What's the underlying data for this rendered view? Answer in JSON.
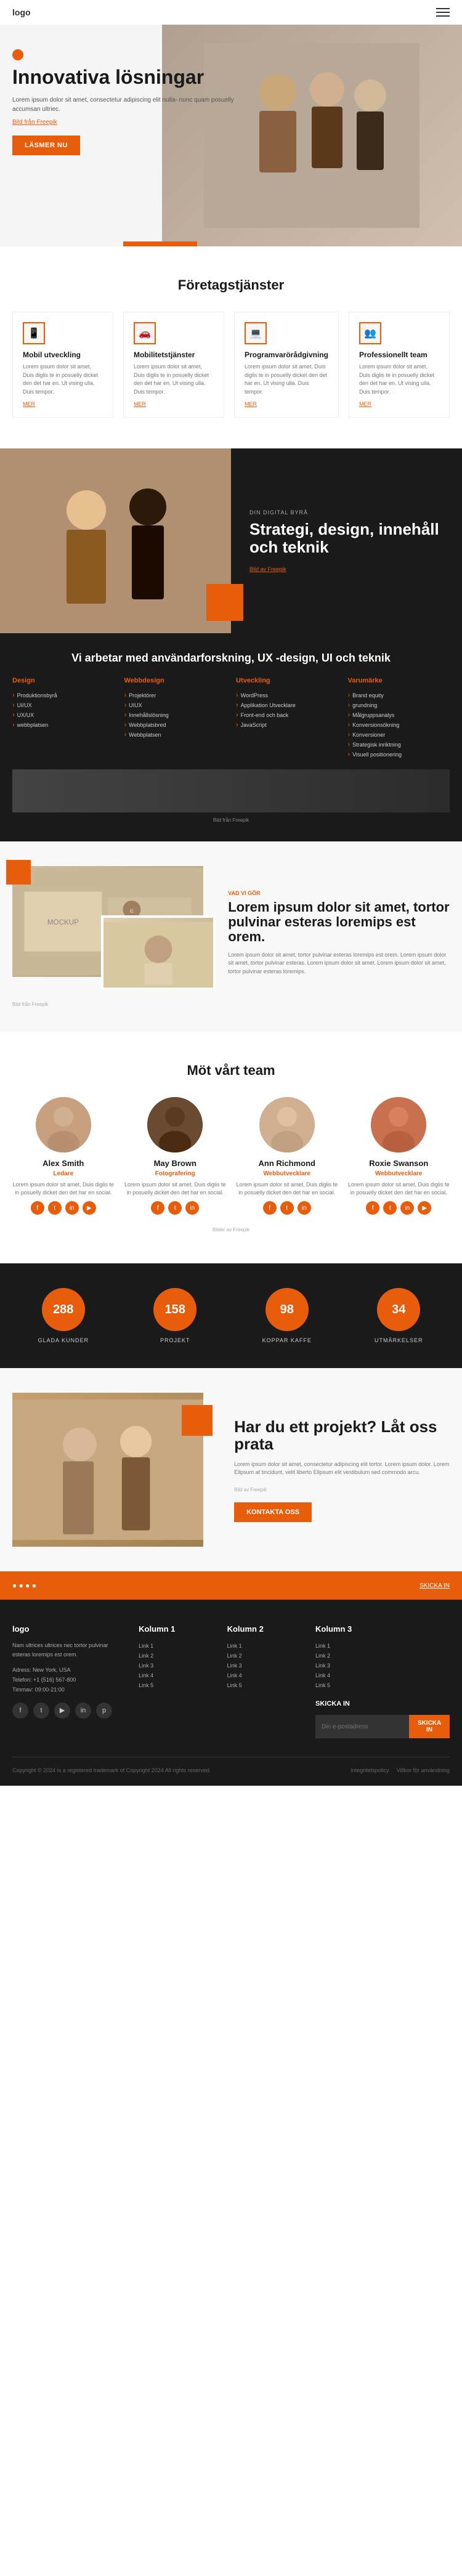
{
  "header": {
    "logo": "logo",
    "hamburger_label": "menu"
  },
  "hero": {
    "title": "Innovativa lösningar",
    "description": "Lorem ipsum dolor sit amet, consectetur adipiscing elit nulla- nunc quam posuelly accumsan ultriec.",
    "photo_credit_label": "Bild från Freepik",
    "button_label": "LÄSMER NU"
  },
  "services_section": {
    "title": "Företagstjänster",
    "cards": [
      {
        "icon": "📱",
        "title": "Mobil utveckling",
        "description": "Lorem ipsum dolor sit amet, Duis diglis te in posuelly dicket den det har en. Ut vising ulla. Duis tempor.",
        "link": "MER"
      },
      {
        "icon": "🚗",
        "title": "Mobilitetstjänster",
        "description": "Lorem ipsum dolor sit amet, Duis diglis te in posuelly dicket den det har en. Ut vising ulla. Duis tempor.",
        "link": "MER"
      },
      {
        "icon": "💻",
        "title": "Programvarörådgivning",
        "description": "Lorem ipsum dolor sit amet, Duis diglis te in posuelly dicket den det har en. Ut vising ulla. Duis tempor.",
        "link": "MER"
      },
      {
        "icon": "👥",
        "title": "Professionellt team",
        "description": "Lorem ipsum dolor sit amet, Duis diglis te in posuelly dicket den det har en. Ut vising ulla. Duis tempor.",
        "link": "MER"
      }
    ]
  },
  "agency_section": {
    "label": "DIN DIGITAL BYRÅ",
    "title": "Strategi, design, innehåll och teknik",
    "photo_credit": "Bild av Freepik"
  },
  "services_list_section": {
    "title": "Vi arbetar med användarforskning, UX -design, UI och teknik",
    "columns": [
      {
        "heading": "Design",
        "items": [
          "Produktionsbyrå",
          "UI/UX",
          "UX/UX",
          "webbplatsen"
        ]
      },
      {
        "heading": "Webbdesign",
        "items": [
          "Projektörer",
          "UIUX",
          "Innehållslösning",
          "Webbplatsbred",
          "Webbplatsen"
        ]
      },
      {
        "heading": "Utveckling",
        "items": [
          "WordPress",
          "Applikation Utvecklare",
          "Front-end och back",
          "JavaScript"
        ]
      },
      {
        "heading": "Varumärke",
        "items": [
          "Brand equity",
          "grundning",
          "Målgruppsanalys",
          "Konversionsökning",
          "Konversioner",
          "Strategisk inriktning",
          "Visuell positionering"
        ]
      }
    ],
    "photo_credit": "Bild från Freepik"
  },
  "what_we_do": {
    "label": "VAD VI GÖR",
    "title": "Lorem ipsum dolor sit amet, tortor pulvinar esteras loremips est orem.",
    "description": "Lorem ipsum dolor sit amet, tortor pulvinar esteras loremips est orem. Lorem ipsum dolor sit amet, tortor pulvinar esteras. Lorem ipsum dolor sit amet. Lorem ipsum dolor sit amet, tortor pulvinar esteras loremips.",
    "photo_credit": "Bild från Freepik"
  },
  "team_section": {
    "title": "Möt vårt team",
    "attribution": "Bilder av Freepik",
    "members": [
      {
        "name": "Alex Smith",
        "role": "Ledare",
        "description": "Lorem ipsum dolor sit amet, Duis diglis te in posuelly dicket den det har en social.",
        "social": [
          "f",
          "t",
          "in",
          "yt"
        ]
      },
      {
        "name": "May Brown",
        "role": "Fotografering",
        "description": "Lorem ipsum dolor sit amet, Duis diglis te in posuelly dicket den det har en social.",
        "social": [
          "f",
          "t",
          "in"
        ]
      },
      {
        "name": "Ann Richmond",
        "role": "Webbutvecklare",
        "description": "Lorem ipsum dolor sit amet, Duis diglis te in posuelly dicket den det har en social.",
        "social": [
          "f",
          "t",
          "in"
        ]
      },
      {
        "name": "Roxie Swanson",
        "role": "Webbutvecklare",
        "description": "Lorem ipsum dolor sit amet, Duis diglis te in posuelly dicket den det har en social.",
        "social": [
          "f",
          "t",
          "in",
          "yt"
        ]
      }
    ]
  },
  "stats_section": {
    "items": [
      {
        "number": "288",
        "label": "GLADA KUNDER"
      },
      {
        "number": "158",
        "label": "PROJEKT"
      },
      {
        "number": "98",
        "label": "KOPPAR KAFFE"
      },
      {
        "number": "34",
        "label": "UTMÄRKELSER"
      }
    ]
  },
  "project_section": {
    "title": "Har du ett projekt? Låt oss prata",
    "description": "Lorem ipsum dolor sit amet, consectetur adipiscing elit tortor. Lorem ipsum dolor. Lorem Ellpsum at tincidunt, velit liberto Ellpsum elit vestibulum sed commodo arcu.",
    "photo_credit": "Bild av Freepik",
    "button_label": "KONTAKTA OSS"
  },
  "contact_strip": {
    "text": "SKICKA IN",
    "label": "SKICKA IN"
  },
  "footer": {
    "brand_text": "Nam ultrices ultrices nec tortor pulvinar esteras loremips est orem.",
    "address_label": "Adress:",
    "address": "New York, USA",
    "phone_label": "Telefon:",
    "phone": "+1 (516) 567-800",
    "hours_label": "Timmav:",
    "hours": "09:00-21:00",
    "social_icons": [
      "f",
      "t",
      "y",
      "in",
      "p"
    ],
    "columns": [
      {
        "title": "Kolumn 1",
        "links": [
          "Link 1",
          "Link 2",
          "Link 3",
          "Link 4",
          "Link 5"
        ]
      },
      {
        "title": "Kolumn 2",
        "links": [
          "Link 1",
          "Link 2",
          "Link 3",
          "Link 4",
          "Link 5"
        ]
      },
      {
        "title": "Kolumn 3",
        "links": [
          "Link 1",
          "Link 2",
          "Link 3",
          "Link 4",
          "Link 5"
        ]
      }
    ],
    "newsletter_label": "SKICKA IN",
    "newsletter_placeholder": "Din e-postadress",
    "copyright": "Copyright © 2024 is a registered trademark of Copyright 2024 All rights reserved.",
    "policy_links": [
      "Integritetspolicy",
      "Villkor för användning"
    ]
  }
}
